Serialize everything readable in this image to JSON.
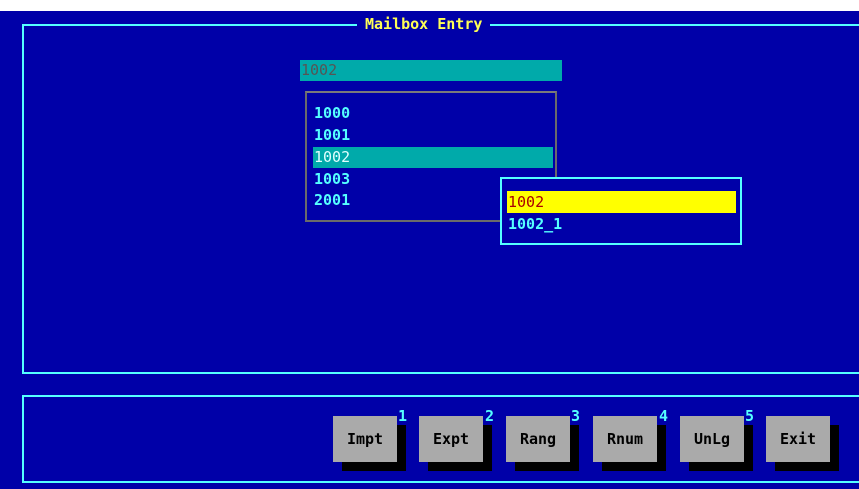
{
  "window": {
    "title": "Mailbox Entry"
  },
  "entry": {
    "value": "1002"
  },
  "mailbox_list": {
    "items": [
      {
        "label": "1000"
      },
      {
        "label": "1001"
      },
      {
        "label": "1002",
        "selected": true
      },
      {
        "label": "1003"
      },
      {
        "label": "2001"
      }
    ]
  },
  "popup": {
    "items": [
      {
        "label": "1002",
        "highlighted": true
      },
      {
        "label": "1002_1"
      }
    ]
  },
  "function_keys": [
    {
      "label": "Impt",
      "number": "1"
    },
    {
      "label": "Expt",
      "number": "2"
    },
    {
      "label": "Rang",
      "number": "3"
    },
    {
      "label": "Rnum",
      "number": "4"
    },
    {
      "label": "UnLg",
      "number": "5"
    },
    {
      "label": "Exit",
      "number": ""
    }
  ],
  "colors": {
    "background": "#0000a8",
    "frame": "#55ffff",
    "title": "#ffff55",
    "selection": "#00aaaa",
    "highlight": "#ffff00",
    "highlight_text": "#aa0000",
    "button": "#aaaaaa"
  }
}
